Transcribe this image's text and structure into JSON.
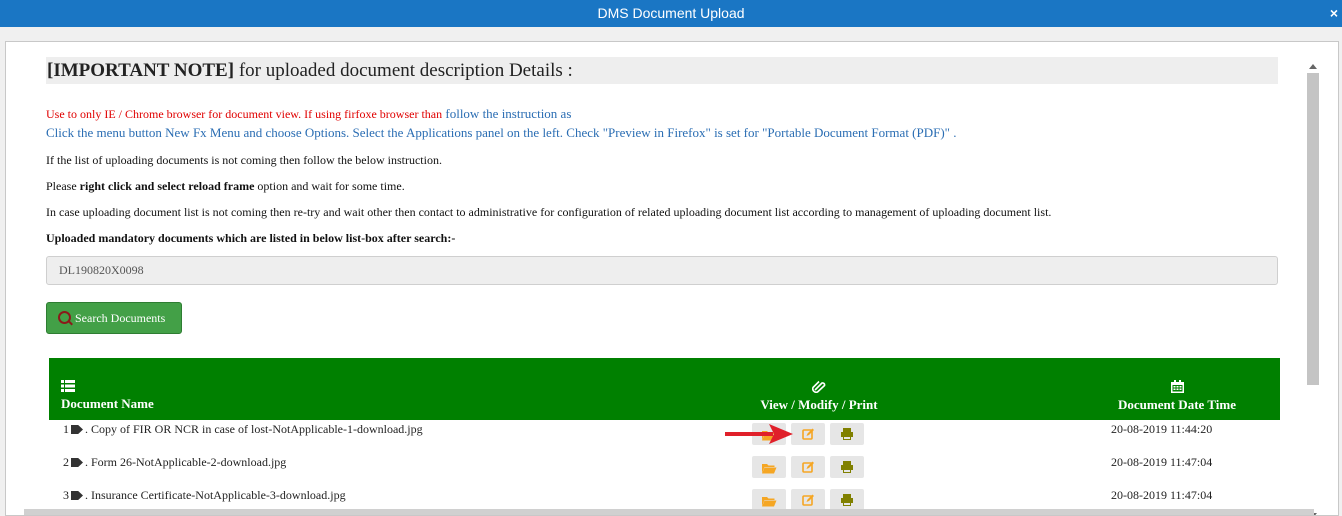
{
  "window": {
    "title": "DMS Document Upload",
    "close_label": "×"
  },
  "note": {
    "heading_bold": "[IMPORTANT NOTE]",
    "heading_rest": " for uploaded document description Details :",
    "browser_red": "Use to only IE / Chrome browser for document view. If using firfoxe browser than",
    "browser_blue": " follow the instruction as",
    "firefox_instruction": "Click the menu button New Fx Menu and choose Options. Select the Applications panel on the left. Check \"Preview in Firefox\" is set for \"Portable Document Format (PDF)\" .",
    "line_list_missing": "If the list of uploading documents is not coming then follow the below instruction.",
    "reload_pre": "Please ",
    "reload_bold": "right click and select reload frame",
    "reload_post": " option and wait for some time.",
    "line_retry": "In case uploading document list is not coming then re-try and wait other then contact to administrative for configuration of related uploading document list according to management of uploading document list.",
    "mandatory_label": "Uploaded mandatory documents which are listed in below list-box after search:-"
  },
  "search": {
    "value": "DL190820X0098",
    "button_label": "Search Documents"
  },
  "table": {
    "col_name": "Document Name",
    "col_actions": "View / Modify / Print",
    "col_datetime": "Document Date Time",
    "rows": [
      {
        "index": "1",
        "name": ". Copy of FIR OR NCR in case of lost-NotApplicable-1-download.jpg",
        "datetime": "20-08-2019 11:44:20"
      },
      {
        "index": "2",
        "name": ". Form 26-NotApplicable-2-download.jpg",
        "datetime": "20-08-2019 11:47:04"
      },
      {
        "index": "3",
        "name": ". Insurance Certificate-NotApplicable-3-download.jpg",
        "datetime": "20-08-2019 11:47:04"
      }
    ]
  },
  "colors": {
    "titlebar": "#1a76c4",
    "table_header": "#008000",
    "search_button": "#43a047",
    "annotation_arrow": "#e0202a",
    "folder_icon": "#f5a623",
    "edit_icon": "#f5a623",
    "print_icon": "#808000"
  }
}
